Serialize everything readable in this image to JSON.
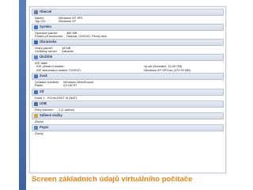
{
  "sections": [
    {
      "id": "general",
      "title": "Obecné",
      "icon": "general-icon",
      "icon_color": "#6b7fa6",
      "rows": [
        {
          "k": "Název:",
          "v": "Windows XP SP3"
        },
        {
          "k": "Typ OS:",
          "v": "Windows XP"
        }
      ]
    },
    {
      "id": "system",
      "title": "Systém",
      "icon": "system-icon",
      "icon_color": "#3e7bc4",
      "rows": [
        {
          "k": "Operační paměť:",
          "v": "384 MB"
        },
        {
          "k": "Pořadí při bootování:",
          "v": "Disketa, CD/DVD, Pevný disk"
        }
      ]
    },
    {
      "id": "display",
      "title": "Obrazovka",
      "icon": "display-icon",
      "icon_color": "#2f6fb5",
      "rows": [
        {
          "k": "Video paměť:",
          "v": "18 MB"
        },
        {
          "k": "Vzdálený server:",
          "v": "Zakázán"
        }
      ]
    },
    {
      "id": "storage",
      "title": "Úložiště",
      "icon": "storage-icon",
      "icon_color": "#5a88c8",
      "rows": [
        {
          "k": "IDE řadič",
          "v": "",
          "rv": ""
        },
        {
          "k": "IDE primární master:",
          "v": "",
          "rv": "xp.vdi (Normální, 10,00 GB)"
        },
        {
          "k": "IDE sekundární master CD/DVD:",
          "v": "",
          "rv": "Windows XP SP3.iso (470,90 MB)"
        }
      ]
    },
    {
      "id": "audio",
      "title": "Zvuk",
      "icon": "audio-icon",
      "icon_color": "#4d79b8",
      "rows": [
        {
          "k": "Ovladač hostitele:",
          "v": "Windows DirectSound"
        },
        {
          "k": "Řadič:",
          "v": "ICH AC97"
        }
      ]
    },
    {
      "id": "network",
      "title": "Síť",
      "icon": "network-icon",
      "icon_color": "#3f78b6",
      "rows": [
        {
          "k": "Karta 1:",
          "v": "PCnet-FAST III (NAT)"
        }
      ]
    },
    {
      "id": "usb",
      "title": "USB",
      "icon": "usb-icon",
      "icon_color": "#4a6fa8",
      "rows": [
        {
          "k": "Filtry zařízení:",
          "v": "1 (1 aktivní)"
        }
      ]
    },
    {
      "id": "shared",
      "title": "Sdílené složky",
      "icon": "shared-folders-icon",
      "icon_color": "#d4a53a",
      "rows": [
        {
          "k": "Žádné",
          "v": "",
          "italic": true
        }
      ]
    },
    {
      "id": "description",
      "title": "Popis",
      "icon": "description-icon",
      "icon_color": "#5a86c2",
      "rows": [
        {
          "k": "Žádný",
          "v": "",
          "italic": true
        }
      ]
    }
  ],
  "caption": "Screen základních údajů virtuálního počítače",
  "colors": {
    "accent_bar": "#3d61a8",
    "caption": "#e8851c",
    "section_title": "#23386b"
  }
}
